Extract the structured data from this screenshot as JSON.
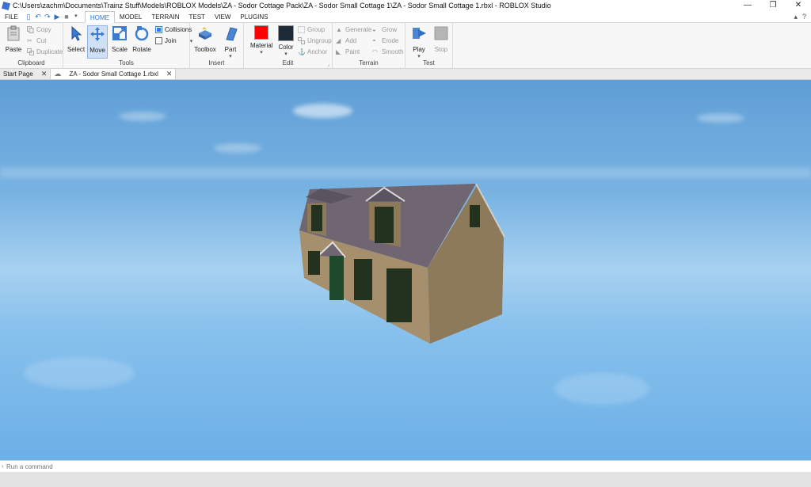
{
  "window": {
    "title": "C:\\Users\\zachm\\Documents\\Trainz Stuff\\Models\\ROBLOX Models\\ZA - Sodor Cottage Pack\\ZA - Sodor Small Cottage 1\\ZA - Sodor Small Cottage 1.rbxl - ROBLOX Studio",
    "controls": {
      "minimize": "—",
      "restore": "❐",
      "close": "✕"
    }
  },
  "menu": {
    "file": "FILE",
    "tabs": [
      "HOME",
      "MODEL",
      "TERRAIN",
      "TEST",
      "VIEW",
      "PLUGINS"
    ],
    "active_tab": "HOME"
  },
  "ribbon": {
    "clipboard": {
      "label": "Clipboard",
      "paste": "Paste",
      "copy": "Copy",
      "cut": "Cut",
      "duplicate": "Duplicate"
    },
    "tools": {
      "label": "Tools",
      "select": "Select",
      "move": "Move",
      "scale": "Scale",
      "rotate": "Rotate",
      "collisions": "Collisions",
      "join": "Join"
    },
    "insert": {
      "label": "Insert",
      "toolbox": "Toolbox",
      "part": "Part"
    },
    "edit": {
      "label": "Edit",
      "material": "Material",
      "color": "Color",
      "group": "Group",
      "ungroup": "Ungroup",
      "anchor": "Anchor",
      "material_color": "#ff0000",
      "color_swatch": "#1e2a38"
    },
    "terrain": {
      "label": "Terrain",
      "generate": "Generate",
      "grow": "Grow",
      "add": "Add",
      "erode": "Erode",
      "paint": "Paint",
      "smooth": "Smooth"
    },
    "test": {
      "label": "Test",
      "play": "Play",
      "stop": "Stop"
    }
  },
  "doc_tabs": [
    {
      "label": "Start Page",
      "close": "✕"
    },
    {
      "label": "ZA - Sodor Small Cottage 1.rbxl",
      "close": "✕"
    }
  ],
  "command_bar": {
    "placeholder": "Run a command"
  }
}
